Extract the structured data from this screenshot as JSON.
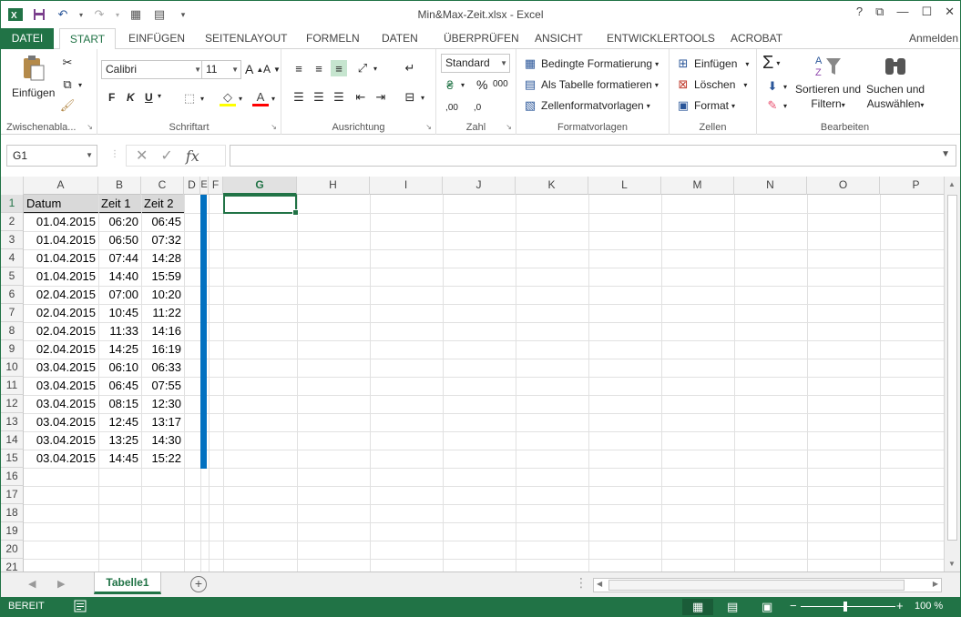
{
  "app": {
    "title": "Min&Max-Zeit.xlsx - Excel",
    "signin": "Anmelden"
  },
  "window_controls": [
    "?",
    "⧉",
    "—",
    "☐",
    "✕"
  ],
  "tabs": [
    {
      "label": "DATEI"
    },
    {
      "label": "START"
    },
    {
      "label": "EINFÜGEN"
    },
    {
      "label": "SEITENLAYOUT"
    },
    {
      "label": "FORMELN"
    },
    {
      "label": "DATEN"
    },
    {
      "label": "ÜBERPRÜFEN"
    },
    {
      "label": "ANSICHT"
    },
    {
      "label": "ENTWICKLERTOOLS"
    },
    {
      "label": "ACROBAT"
    }
  ],
  "ribbon": {
    "clipboard": {
      "paste": "Einfügen",
      "label": "Zwischenabla..."
    },
    "font": {
      "name": "Calibri",
      "size": "11",
      "bold": "F",
      "italic": "K",
      "underline": "U",
      "grow": "A",
      "shrink": "A",
      "label": "Schriftart"
    },
    "alignment": {
      "label": "Ausrichtung"
    },
    "number": {
      "format": "Standard",
      "percent": "%",
      "thousands": "000",
      "label": "Zahl"
    },
    "styles": {
      "conditional": "Bedingte Formatierung",
      "as_table": "Als Tabelle formatieren",
      "cell_styles": "Zellenformatvorlagen",
      "label": "Formatvorlagen"
    },
    "cells": {
      "insert": "Einfügen",
      "delete": "Löschen",
      "format": "Format",
      "label": "Zellen"
    },
    "editing": {
      "sort": "Sortieren und",
      "sort2": "Filtern",
      "find": "Suchen und",
      "find2": "Auswählen",
      "label": "Bearbeiten"
    }
  },
  "formula_bar": {
    "name_box": "G1",
    "cancel": "✕",
    "enter": "✓",
    "fx": "fx",
    "value": ""
  },
  "columns": [
    "A",
    "B",
    "C",
    "D",
    "E",
    "F",
    "G",
    "H",
    "I",
    "J",
    "K",
    "L",
    "M",
    "N",
    "O",
    "P"
  ],
  "selected_column": "G",
  "rows": [
    "1",
    "2",
    "3",
    "4",
    "5",
    "6",
    "7",
    "8",
    "9",
    "10",
    "11",
    "12",
    "13",
    "14",
    "15",
    "16",
    "17",
    "18",
    "19",
    "20",
    "21"
  ],
  "sheet": {
    "header": [
      "Datum",
      "Zeit 1",
      "Zeit 2"
    ],
    "data": [
      [
        "01.04.2015",
        "06:20",
        "06:45"
      ],
      [
        "01.04.2015",
        "06:50",
        "07:32"
      ],
      [
        "01.04.2015",
        "07:44",
        "14:28"
      ],
      [
        "01.04.2015",
        "14:40",
        "15:59"
      ],
      [
        "02.04.2015",
        "07:00",
        "10:20"
      ],
      [
        "02.04.2015",
        "10:45",
        "11:22"
      ],
      [
        "02.04.2015",
        "11:33",
        "14:16"
      ],
      [
        "02.04.2015",
        "14:25",
        "16:19"
      ],
      [
        "03.04.2015",
        "06:10",
        "06:33"
      ],
      [
        "03.04.2015",
        "06:45",
        "07:55"
      ],
      [
        "03.04.2015",
        "08:15",
        "12:30"
      ],
      [
        "03.04.2015",
        "12:45",
        "13:17"
      ],
      [
        "03.04.2015",
        "13:25",
        "14:30"
      ],
      [
        "03.04.2015",
        "14:45",
        "15:22"
      ]
    ]
  },
  "sheet_tabs": {
    "active": "Tabelle1",
    "add": "+"
  },
  "status": {
    "ready": "BEREIT",
    "zoom": "100 %",
    "minus": "−",
    "plus": "+"
  }
}
